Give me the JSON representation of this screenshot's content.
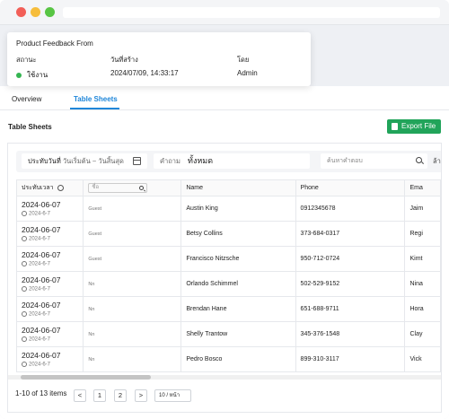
{
  "info": {
    "title": "Product Feedback From",
    "status_label": "สถานะ",
    "created_label": "วันที่สร้าง",
    "by_label": "โดย",
    "status_value": "ใช้งาน",
    "created_value": "2024/07/09, 14:33:17",
    "by_value": "Admin",
    "status_color": "#35b552"
  },
  "tabs": [
    {
      "label": "Overview",
      "active": false
    },
    {
      "label": "Table Sheets",
      "active": true
    }
  ],
  "section_title": "Table Sheets",
  "export_label": "Export File",
  "filters": {
    "date_label": "ประทับวันที่",
    "date_start": "วันเริ่มต้น",
    "date_sep": "~",
    "date_end": "วันสิ้นสุด",
    "question_label": "คำถาม",
    "question_value": "ทั้งหมด",
    "answer_placeholder": "ค้นหาคำตอบ",
    "clear_label": "ล้าง"
  },
  "table": {
    "columns": [
      "ประทับเวลา",
      "ชื่อ",
      "Name",
      "Phone",
      "Ema"
    ],
    "name_filter_placeholder": "ชื่อ",
    "rows": [
      {
        "date": "2024-06-07",
        "time": "2024-6-7",
        "user": "Guest",
        "name": "Austin King",
        "phone": "0912345678",
        "email": "Jaim"
      },
      {
        "date": "2024-06-07",
        "time": "2024-6-7",
        "user": "Guest",
        "name": "Betsy Collins",
        "phone": "373-684-0317",
        "email": "Regi"
      },
      {
        "date": "2024-06-07",
        "time": "2024-6-7",
        "user": "Guest",
        "name": "Francisco Nitzsche",
        "phone": "950-712-0724",
        "email": "Kimt"
      },
      {
        "date": "2024-06-07",
        "time": "2024-6-7",
        "user": "Nn",
        "name": "Orlando Schimmel",
        "phone": "502-529-9152",
        "email": "Nina"
      },
      {
        "date": "2024-06-07",
        "time": "2024-6-7",
        "user": "Nn",
        "name": "Brendan Hane",
        "phone": "651-688-9711",
        "email": "Hora"
      },
      {
        "date": "2024-06-07",
        "time": "2024-6-7",
        "user": "Nn",
        "name": "Shelly Trantow",
        "phone": "345-376-1548",
        "email": "Clay"
      },
      {
        "date": "2024-06-07",
        "time": "2024-6-7",
        "user": "Nn",
        "name": "Pedro Bosco",
        "phone": "899-310-3117",
        "email": "Vick"
      }
    ]
  },
  "pagination": {
    "summary": "1-10 of 13 items",
    "prev": "<",
    "pages": [
      "1",
      "2"
    ],
    "next": ">",
    "page_size": "10 / หน้า"
  }
}
